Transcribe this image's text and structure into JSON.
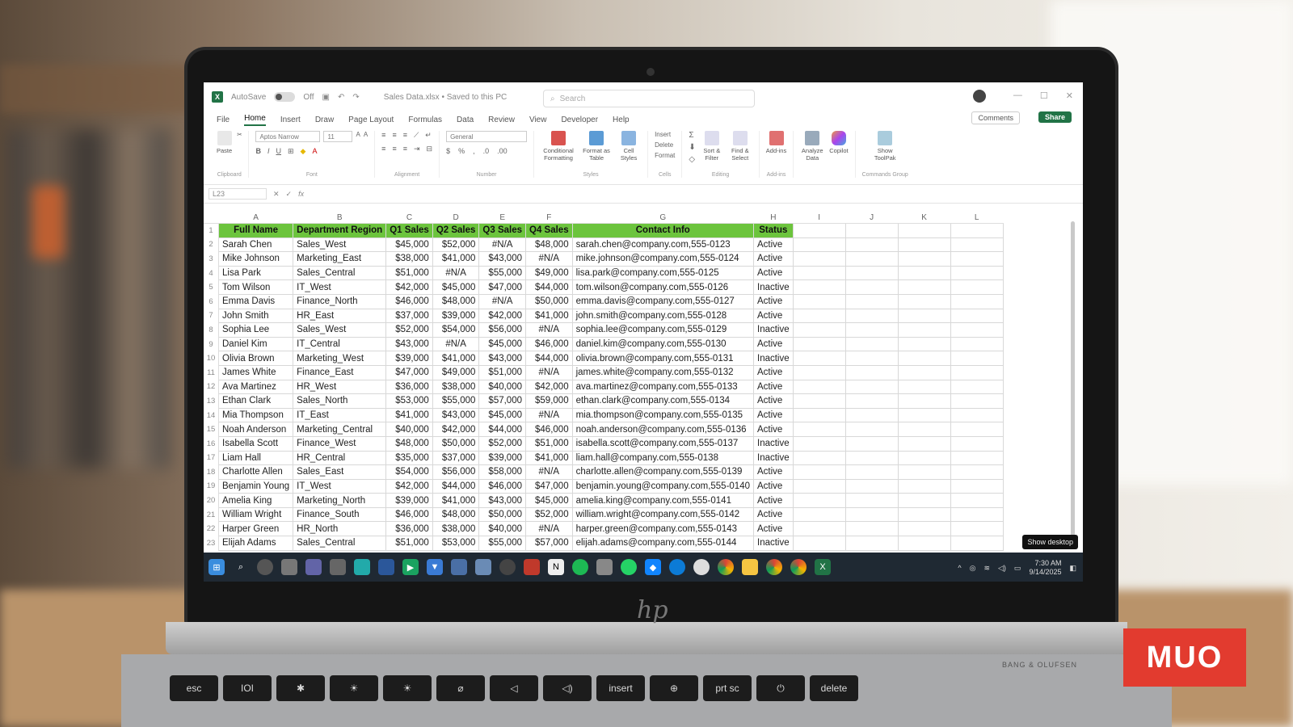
{
  "window": {
    "autosave": "AutoSave",
    "autosave_state": "Off",
    "title": "Sales Data.xlsx • Saved to this PC",
    "search_placeholder": "Search"
  },
  "menu_tabs": [
    "File",
    "Home",
    "Insert",
    "Draw",
    "Page Layout",
    "Formulas",
    "Data",
    "Review",
    "View",
    "Developer",
    "Help"
  ],
  "actions": {
    "comments": "Comments",
    "share": "Share"
  },
  "ribbon": {
    "clipboard": {
      "paste": "Paste",
      "label": "Clipboard"
    },
    "font": {
      "family": "Aptos Narrow",
      "size": "11",
      "label": "Font"
    },
    "alignment": {
      "label": "Alignment"
    },
    "number": {
      "format": "General",
      "label": "Number"
    },
    "styles": {
      "conditional": "Conditional Formatting",
      "format_table": "Format as Table",
      "cell_styles": "Cell Styles",
      "label": "Styles"
    },
    "cells": {
      "insert": "Insert",
      "delete": "Delete",
      "format": "Format",
      "label": "Cells"
    },
    "editing": {
      "sort": "Sort & Filter",
      "find": "Find & Select",
      "label": "Editing"
    },
    "addins": {
      "addins": "Add-ins",
      "label": "Add-ins"
    },
    "analyze": {
      "analyze": "Analyze Data",
      "copilot": "Copilot"
    },
    "commands": {
      "show": "Show ToolPak",
      "label": "Commands Group"
    }
  },
  "formula_bar": {
    "name_box": "L23",
    "fx": "fx"
  },
  "columns": [
    "A",
    "B",
    "C",
    "D",
    "E",
    "F",
    "G",
    "H",
    "I",
    "J",
    "K",
    "L"
  ],
  "headers": [
    "Full Name",
    "Department Region",
    "Q1 Sales",
    "Q2 Sales",
    "Q3 Sales",
    "Q4 Sales",
    "Contact Info",
    "Status"
  ],
  "rows": [
    [
      "Sarah Chen",
      "Sales_West",
      "$45,000",
      "$52,000",
      "#N/A",
      "$48,000",
      "sarah.chen@company.com,555-0123",
      "Active"
    ],
    [
      "Mike Johnson",
      "Marketing_East",
      "$38,000",
      "$41,000",
      "$43,000",
      "#N/A",
      "mike.johnson@company.com,555-0124",
      "Active"
    ],
    [
      "Lisa Park",
      "Sales_Central",
      "$51,000",
      "#N/A",
      "$55,000",
      "$49,000",
      "lisa.park@company.com,555-0125",
      "Active"
    ],
    [
      "Tom Wilson",
      "IT_West",
      "$42,000",
      "$45,000",
      "$47,000",
      "$44,000",
      "tom.wilson@company.com,555-0126",
      "Inactive"
    ],
    [
      "Emma Davis",
      "Finance_North",
      "$46,000",
      "$48,000",
      "#N/A",
      "$50,000",
      "emma.davis@company.com,555-0127",
      "Active"
    ],
    [
      "John Smith",
      "HR_East",
      "$37,000",
      "$39,000",
      "$42,000",
      "$41,000",
      "john.smith@company.com,555-0128",
      "Active"
    ],
    [
      "Sophia Lee",
      "Sales_West",
      "$52,000",
      "$54,000",
      "$56,000",
      "#N/A",
      "sophia.lee@company.com,555-0129",
      "Inactive"
    ],
    [
      "Daniel Kim",
      "IT_Central",
      "$43,000",
      "#N/A",
      "$45,000",
      "$46,000",
      "daniel.kim@company.com,555-0130",
      "Active"
    ],
    [
      "Olivia Brown",
      "Marketing_West",
      "$39,000",
      "$41,000",
      "$43,000",
      "$44,000",
      "olivia.brown@company.com,555-0131",
      "Inactive"
    ],
    [
      "James White",
      "Finance_East",
      "$47,000",
      "$49,000",
      "$51,000",
      "#N/A",
      "james.white@company.com,555-0132",
      "Active"
    ],
    [
      "Ava Martinez",
      "HR_West",
      "$36,000",
      "$38,000",
      "$40,000",
      "$42,000",
      "ava.martinez@company.com,555-0133",
      "Active"
    ],
    [
      "Ethan Clark",
      "Sales_North",
      "$53,000",
      "$55,000",
      "$57,000",
      "$59,000",
      "ethan.clark@company.com,555-0134",
      "Active"
    ],
    [
      "Mia Thompson",
      "IT_East",
      "$41,000",
      "$43,000",
      "$45,000",
      "#N/A",
      "mia.thompson@company.com,555-0135",
      "Active"
    ],
    [
      "Noah Anderson",
      "Marketing_Central",
      "$40,000",
      "$42,000",
      "$44,000",
      "$46,000",
      "noah.anderson@company.com,555-0136",
      "Active"
    ],
    [
      "Isabella Scott",
      "Finance_West",
      "$48,000",
      "$50,000",
      "$52,000",
      "$51,000",
      "isabella.scott@company.com,555-0137",
      "Inactive"
    ],
    [
      "Liam Hall",
      "HR_Central",
      "$35,000",
      "$37,000",
      "$39,000",
      "$41,000",
      "liam.hall@company.com,555-0138",
      "Inactive"
    ],
    [
      "Charlotte Allen",
      "Sales_East",
      "$54,000",
      "$56,000",
      "$58,000",
      "#N/A",
      "charlotte.allen@company.com,555-0139",
      "Active"
    ],
    [
      "Benjamin Young",
      "IT_West",
      "$42,000",
      "$44,000",
      "$46,000",
      "$47,000",
      "benjamin.young@company.com,555-0140",
      "Active"
    ],
    [
      "Amelia King",
      "Marketing_North",
      "$39,000",
      "$41,000",
      "$43,000",
      "$45,000",
      "amelia.king@company.com,555-0141",
      "Active"
    ],
    [
      "William Wright",
      "Finance_South",
      "$46,000",
      "$48,000",
      "$50,000",
      "$52,000",
      "william.wright@company.com,555-0142",
      "Active"
    ],
    [
      "Harper Green",
      "HR_North",
      "$36,000",
      "$38,000",
      "$40,000",
      "#N/A",
      "harper.green@company.com,555-0143",
      "Active"
    ],
    [
      "Elijah Adams",
      "Sales_Central",
      "$51,000",
      "$53,000",
      "$55,000",
      "$57,000",
      "elijah.adams@company.com,555-0144",
      "Inactive"
    ]
  ],
  "taskbar": {
    "show_desktop": "Show desktop",
    "time": "7:30 AM",
    "date": "9/14/2025",
    "icons": [
      "windows-start",
      "search",
      "copilot",
      "widgets",
      "teams",
      "phone",
      "store",
      "word",
      "play",
      "vpn",
      "notepad",
      "calculator",
      "clock",
      "photos",
      "notion",
      "spotify",
      "mail",
      "whatsapp",
      "bluesky",
      "edge",
      "chatgpt",
      "chrome",
      "explorer",
      "chrome-alt",
      "chrome-dev",
      "excel"
    ]
  },
  "colors": {
    "header_green": "#6cc43d",
    "excel_green": "#217346",
    "taskbar": "#1f2933",
    "brand": "#e23b2f"
  },
  "laptop": {
    "brand_stamp": "BANG & OLUFSEN"
  },
  "watermark": "MUO",
  "keys": [
    "esc",
    "",
    "",
    "",
    "",
    "",
    "",
    "",
    "insert",
    "",
    "prt sc",
    "",
    "delete"
  ]
}
